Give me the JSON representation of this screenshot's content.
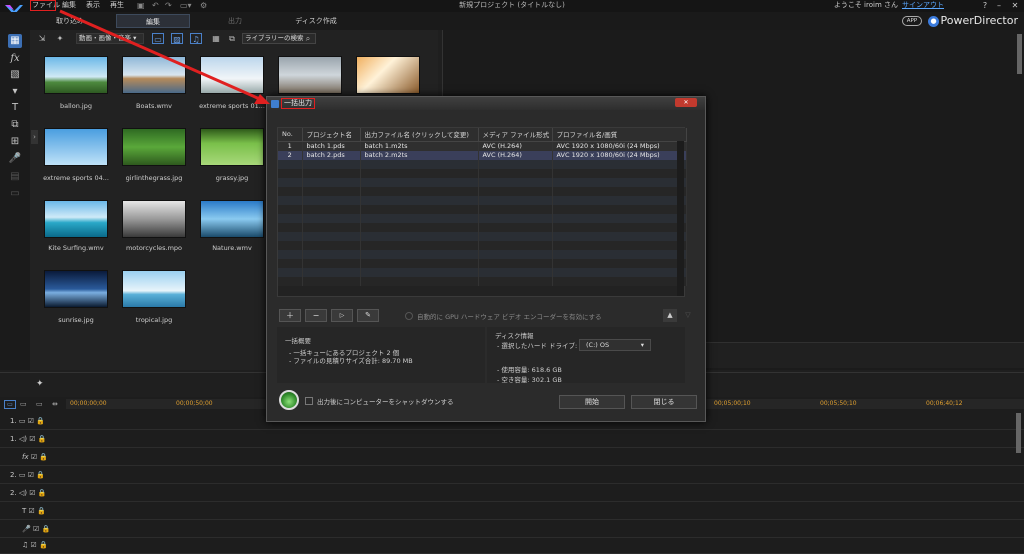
{
  "app": {
    "brand": "PowerDirector",
    "project_title": "新規プロジェクト (タイトルなし)",
    "welcome": "ようこそ iroim さん",
    "signout": "サインアウト",
    "app_badge": "APP",
    "menu": [
      "ファイル",
      "編集",
      "表示",
      "再生"
    ]
  },
  "tabs": [
    "取り込み",
    "編集",
    "出力",
    "ディスク作成"
  ],
  "library": {
    "filter": "動画・画像・音楽",
    "search_placeholder": "ライブラリーの検索",
    "items": [
      {
        "label": "ballon.jpg"
      },
      {
        "label": "Boats.wmv"
      },
      {
        "label": "extreme sports 01..."
      },
      {
        "label": "extreme sports 04..."
      },
      {
        "label": "girlinthegrass.jpg"
      },
      {
        "label": "grassy.jpg"
      },
      {
        "label": "Kite Surfing.wmv"
      },
      {
        "label": "motorcycles.mpo"
      },
      {
        "label": "Nature.wmv"
      },
      {
        "label": "sunrise.jpg"
      },
      {
        "label": "tropical.jpg"
      }
    ]
  },
  "timeline": {
    "ruler": [
      "00;00;00;00",
      "00;00;50;00",
      "00;05;00;10",
      "00;05;50;10",
      "00;06;40;12"
    ],
    "tracks": [
      "1.",
      "1.",
      "",
      "2.",
      "2.",
      "",
      "",
      ""
    ]
  },
  "dialog": {
    "title": "一括出力",
    "columns": [
      "No.",
      "プロジェクト名",
      "出力ファイル名 (クリックして変更)",
      "メディア ファイル形式",
      "プロファイル名/画質"
    ],
    "rows": [
      {
        "no": "1",
        "project": "batch 1.pds",
        "output": "batch 1.m2ts",
        "format": "AVC (H.264)",
        "profile": "AVC 1920 x 1080/60i (24 Mbps)"
      },
      {
        "no": "2",
        "project": "batch 2.pds",
        "output": "batch 2.m2ts",
        "format": "AVC (H.264)",
        "profile": "AVC 1920 x 1080/60i (24 Mbps)"
      }
    ],
    "gpu_label": "自動的に GPU ハードウェア ビデオ エンコーダーを有効にする",
    "summary": {
      "heading": "一括概要",
      "line1": "- 一括キューにあるプロジェクト 2 個",
      "line2": "- ファイルの見積りサイズ合計: 89.70 MB"
    },
    "disk": {
      "heading": "ディスク情報",
      "drive_label": "- 選択したハード ドライブ:",
      "drive_value": "(C:) OS",
      "used": "- 使用容量: 618.6 GB",
      "free": "- 空き容量: 302.1 GB"
    },
    "shutdown_label": "出力後にコンピューターをシャットダウンする",
    "start_button": "開始",
    "close_button": "閉じる"
  }
}
